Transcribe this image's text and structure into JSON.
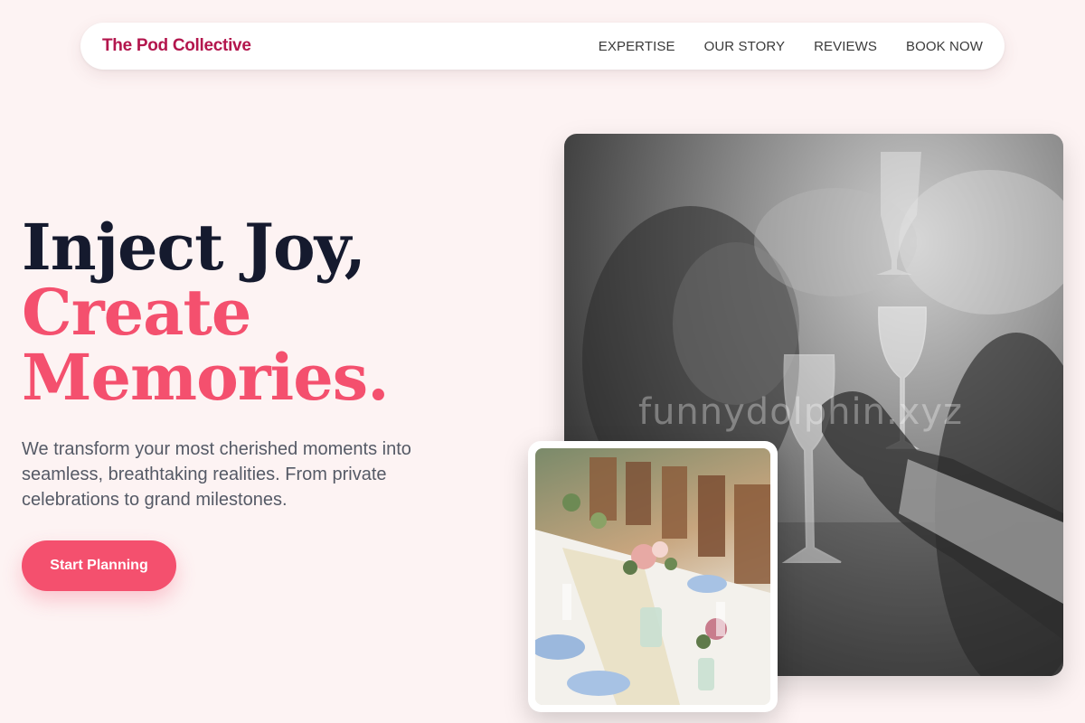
{
  "nav": {
    "brand": "The Pod Collective",
    "links": [
      "EXPERTISE",
      "OUR STORY",
      "REVIEWS",
      "BOOK NOW"
    ]
  },
  "hero": {
    "headline_line1": "Inject Joy,",
    "headline_line2": "Create",
    "headline_line3": "Memories.",
    "subtext": "We transform your most cherished moments into seamless, breathtaking realities. From private celebrations to grand milestones.",
    "cta_label": "Start Planning"
  },
  "images": {
    "main_watermark": "funnydolphin.xyz"
  },
  "colors": {
    "background": "#fdf3f3",
    "brand": "#b3164d",
    "accent": "#f4506e",
    "heading": "#151a2e",
    "body": "#555a66"
  }
}
